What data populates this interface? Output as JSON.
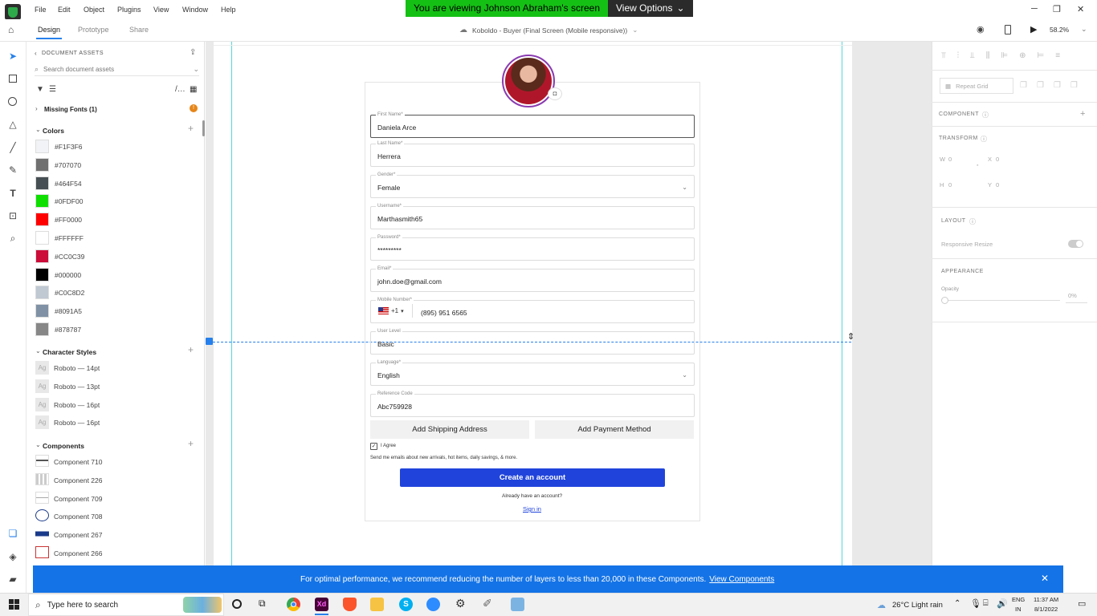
{
  "menubar": {
    "items": [
      "File",
      "Edit",
      "Object",
      "Plugins",
      "View",
      "Window",
      "Help"
    ],
    "share_banner": "You are viewing Johnson Abraham's screen",
    "view_options": "View Options"
  },
  "toolbar": {
    "tabs": [
      "Design",
      "Prototype",
      "Share"
    ],
    "doc_title": "Koboldo - Buyer (Final Screen (Mobile responsive))",
    "zoom": "58.2%"
  },
  "assets": {
    "header": "DOCUMENT ASSETS",
    "search_placeholder": "Search document assets",
    "missing_fonts": "Missing Fonts (1)",
    "colors_title": "Colors",
    "colors": [
      {
        "hex": "#F1F3F6"
      },
      {
        "hex": "#707070"
      },
      {
        "hex": "#464F54"
      },
      {
        "hex": "#0FDF00"
      },
      {
        "hex": "#FF0000"
      },
      {
        "hex": "#FFFFFF"
      },
      {
        "hex": "#CC0C39"
      },
      {
        "hex": "#000000"
      },
      {
        "hex": "#C0C8D2"
      },
      {
        "hex": "#8091A5"
      },
      {
        "hex": "#878787"
      }
    ],
    "char_styles_title": "Character Styles",
    "char_styles": [
      "Roboto — 14pt",
      "Roboto — 13pt",
      "Roboto — 16pt",
      "Roboto — 16pt"
    ],
    "components_title": "Components",
    "components": [
      "Component 710",
      "Component 226",
      "Component 709",
      "Component 708",
      "Component 267",
      "Component 266"
    ]
  },
  "form": {
    "fields": [
      {
        "label": "First Name*",
        "value": "Daniela Arce"
      },
      {
        "label": "Last Name*",
        "value": "Herrera"
      },
      {
        "label": "Gender*",
        "value": "Female"
      },
      {
        "label": "Username*",
        "value": "Marthasmith65"
      },
      {
        "label": "Password*",
        "value": "*********"
      },
      {
        "label": "Email*",
        "value": "john.doe@gmail.com"
      },
      {
        "label": "Mobile Number*",
        "value": "(895) 951 6565"
      },
      {
        "label": "User Level",
        "value": "Basic"
      },
      {
        "label": "Language*",
        "value": "English"
      },
      {
        "label": "Reference Code",
        "value": "Abc759928"
      }
    ],
    "country_code": "+1",
    "add_shipping": "Add Shipping Address",
    "add_payment": "Add Payment Method",
    "agree": "I Agree",
    "newsletter": "Send me emails about new arrivals, hot items, daily savings, & more.",
    "create_account": "Create an account",
    "already": "Already have an account?",
    "signin": "Sign in"
  },
  "right_panel": {
    "repeat_grid": "Repeat Grid",
    "component": "COMPONENT",
    "transform": "TRANSFORM",
    "w_label": "W",
    "w": "0",
    "x_label": "X",
    "x": "0",
    "h_label": "H",
    "h": "0",
    "y_label": "Y",
    "y": "0",
    "layout": "LAYOUT",
    "responsive_resize": "Responsive Resize",
    "appearance": "APPEARANCE",
    "opacity_label": "Opacity",
    "opacity": "0%"
  },
  "notice": {
    "text": "For optimal performance, we recommend reducing the number of layers to less than 20,000 in these Components.",
    "link": "View Components"
  },
  "taskbar": {
    "search": "Type here to search",
    "weather": "26°C  Light rain",
    "lang1": "ENG",
    "lang2": "IN",
    "time": "11:37 AM",
    "date": "8/1/2022"
  },
  "colors": {
    "accent": "#2680eb",
    "primary_btn": "#2044db",
    "banner_green": "#15c015",
    "notice_blue": "#1473e6"
  }
}
